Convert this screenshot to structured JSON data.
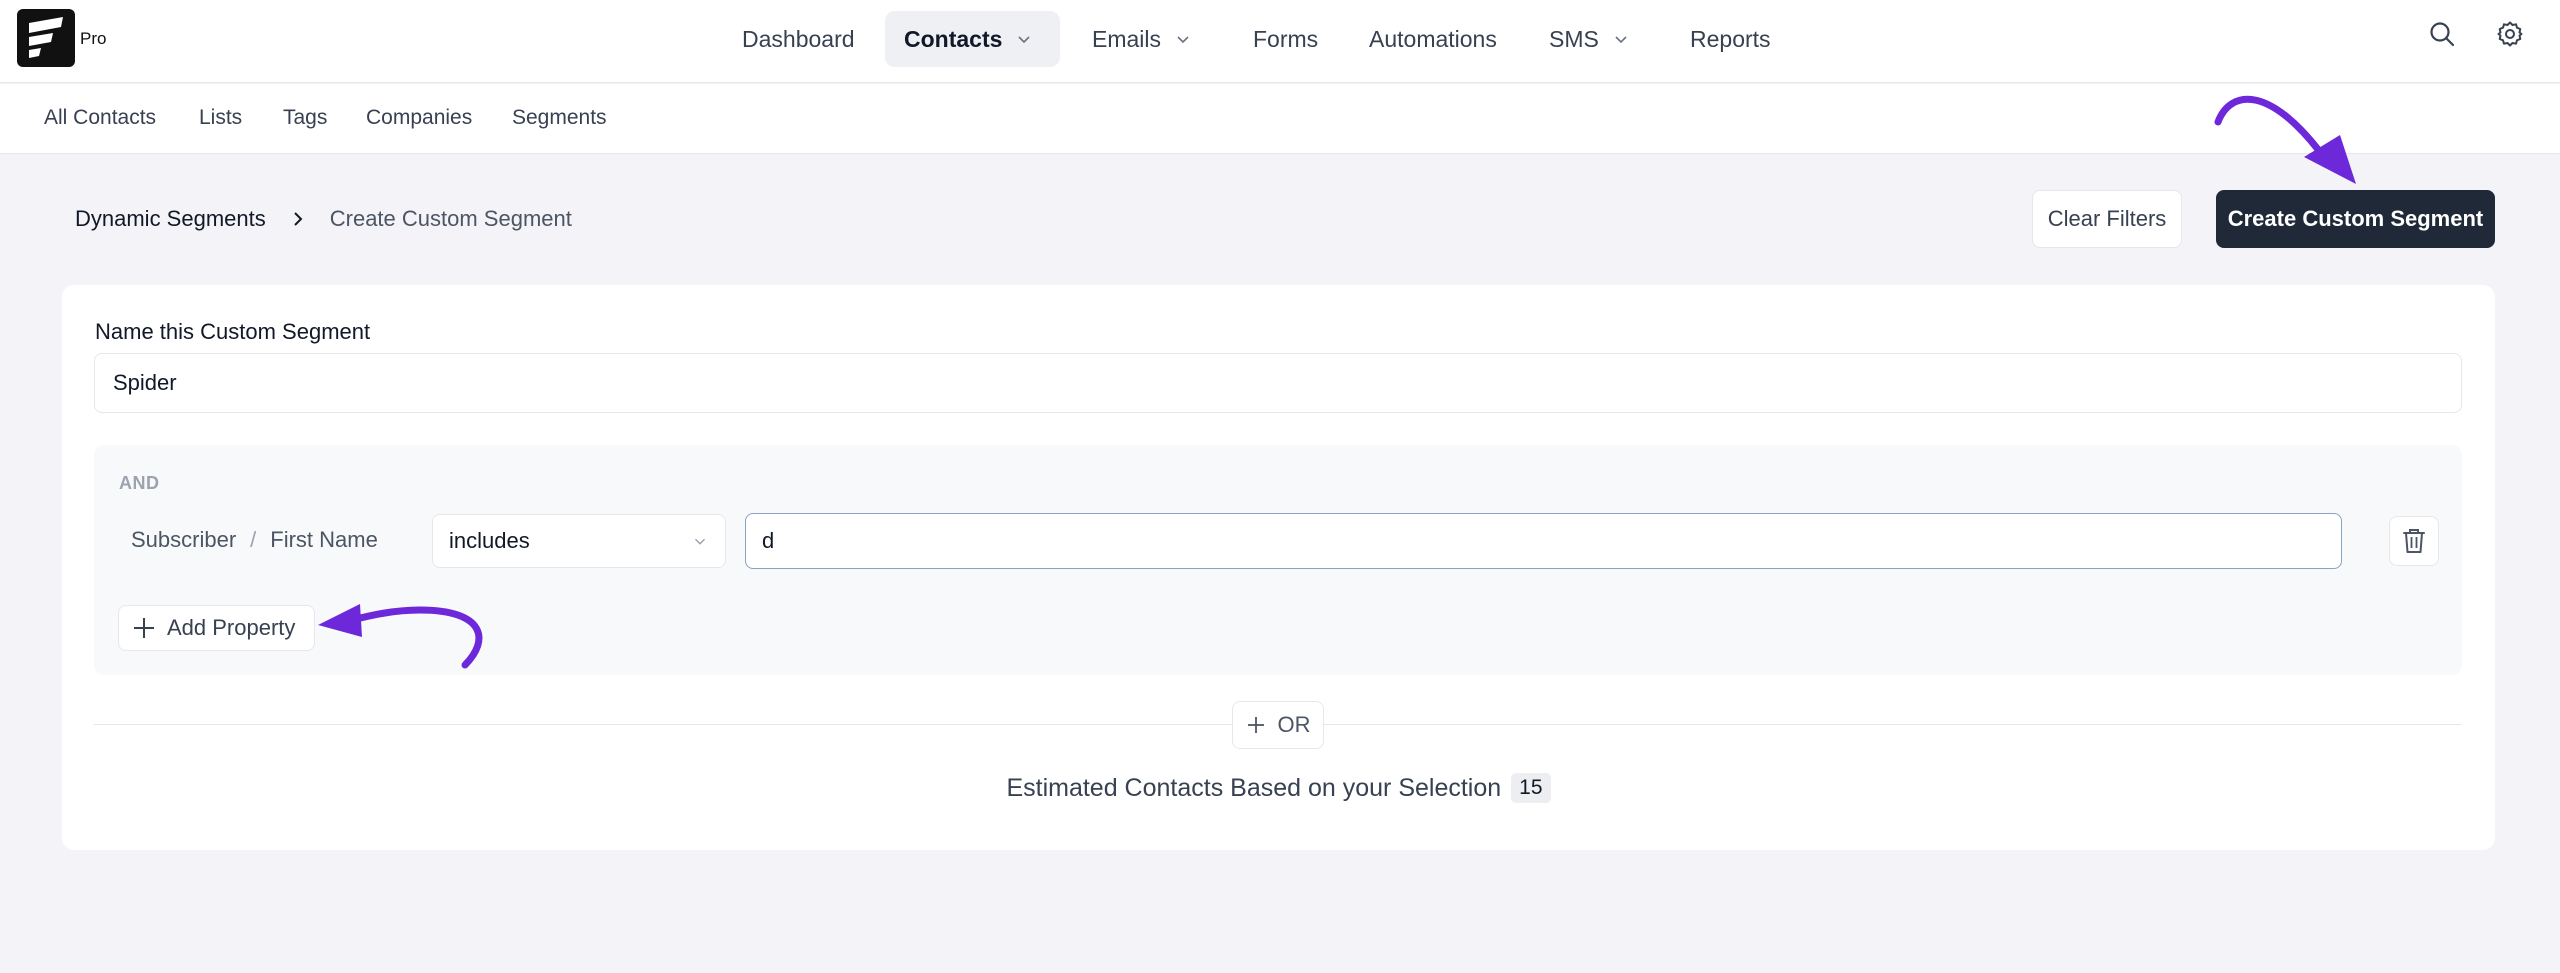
{
  "brand": {
    "badge": "Pro"
  },
  "nav": {
    "items": [
      {
        "label": "Dashboard"
      },
      {
        "label": "Contacts"
      },
      {
        "label": "Emails"
      },
      {
        "label": "Forms"
      },
      {
        "label": "Automations"
      },
      {
        "label": "SMS"
      },
      {
        "label": "Reports"
      }
    ],
    "active": "Contacts"
  },
  "subnav": {
    "items": [
      {
        "label": "All Contacts"
      },
      {
        "label": "Lists"
      },
      {
        "label": "Tags"
      },
      {
        "label": "Companies"
      },
      {
        "label": "Segments"
      }
    ]
  },
  "breadcrumb": {
    "parent": "Dynamic Segments",
    "current": "Create Custom Segment"
  },
  "actions": {
    "clear_filters": "Clear Filters",
    "create_segment": "Create Custom Segment"
  },
  "form": {
    "name_label": "Name this Custom Segment",
    "name_value": "Spider",
    "group_label": "AND",
    "condition": {
      "property_group": "Subscriber",
      "separator": "/",
      "property": "First Name",
      "operator": "includes",
      "value": "d"
    },
    "add_property_label": "Add Property",
    "or_label": "OR"
  },
  "estimate": {
    "label": "Estimated Contacts Based on your Selection",
    "count": "15"
  },
  "colors": {
    "annotation_arrow": "#6d28d9",
    "primary_button": "#1f2937"
  }
}
